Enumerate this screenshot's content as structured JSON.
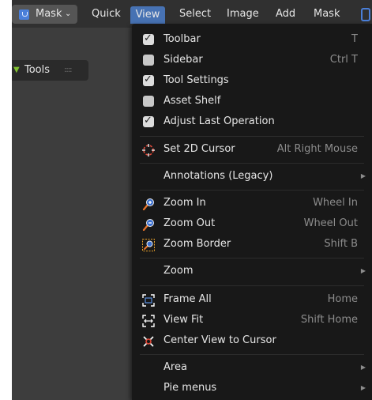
{
  "header": {
    "mode_label": "Mask",
    "mode_chevron": "⌄",
    "menus": [
      "Quick",
      "View",
      "Select",
      "Image",
      "Add",
      "Mask"
    ]
  },
  "tools_panel": {
    "label": "Tools",
    "grip": "::::"
  },
  "view_menu": {
    "items": [
      {
        "label": "Toolbar",
        "shortcut": "T",
        "checked": true
      },
      {
        "label": "Sidebar",
        "shortcut": "Ctrl T",
        "checked": false
      },
      {
        "label": "Tool Settings",
        "shortcut": "",
        "checked": true
      },
      {
        "label": "Asset Shelf",
        "shortcut": "",
        "checked": false
      },
      {
        "label": "Adjust Last Operation",
        "shortcut": "",
        "checked": true
      },
      {
        "label": "Set 2D Cursor",
        "shortcut": "Alt Right Mouse",
        "icon": "cursor-target-icon"
      },
      {
        "label": "Annotations (Legacy)",
        "submenu": true
      },
      {
        "label": "Zoom In",
        "shortcut": "Wheel In",
        "icon": "zoom-in-icon"
      },
      {
        "label": "Zoom Out",
        "shortcut": "Wheel Out",
        "icon": "zoom-out-icon"
      },
      {
        "label": "Zoom Border",
        "shortcut": "Shift B",
        "icon": "zoom-border-icon"
      },
      {
        "label": "Zoom",
        "submenu": true
      },
      {
        "label": "Frame All",
        "shortcut": "Home",
        "icon": "frame-all-icon"
      },
      {
        "label": "View Fit",
        "shortcut": "Shift Home",
        "icon": "view-fit-icon"
      },
      {
        "label": "Center View to Cursor",
        "shortcut": "",
        "icon": "center-view-icon"
      },
      {
        "label": "Area",
        "submenu": true
      },
      {
        "label": "Pie menus",
        "submenu": true
      }
    ],
    "submenu_arrow": "▶"
  },
  "colors": {
    "accent": "#4772b3",
    "menu_bg": "#181818",
    "header_bg": "#303030",
    "shortcut_text": "#8c8c8c",
    "zoom_icon": "#e8732a"
  }
}
